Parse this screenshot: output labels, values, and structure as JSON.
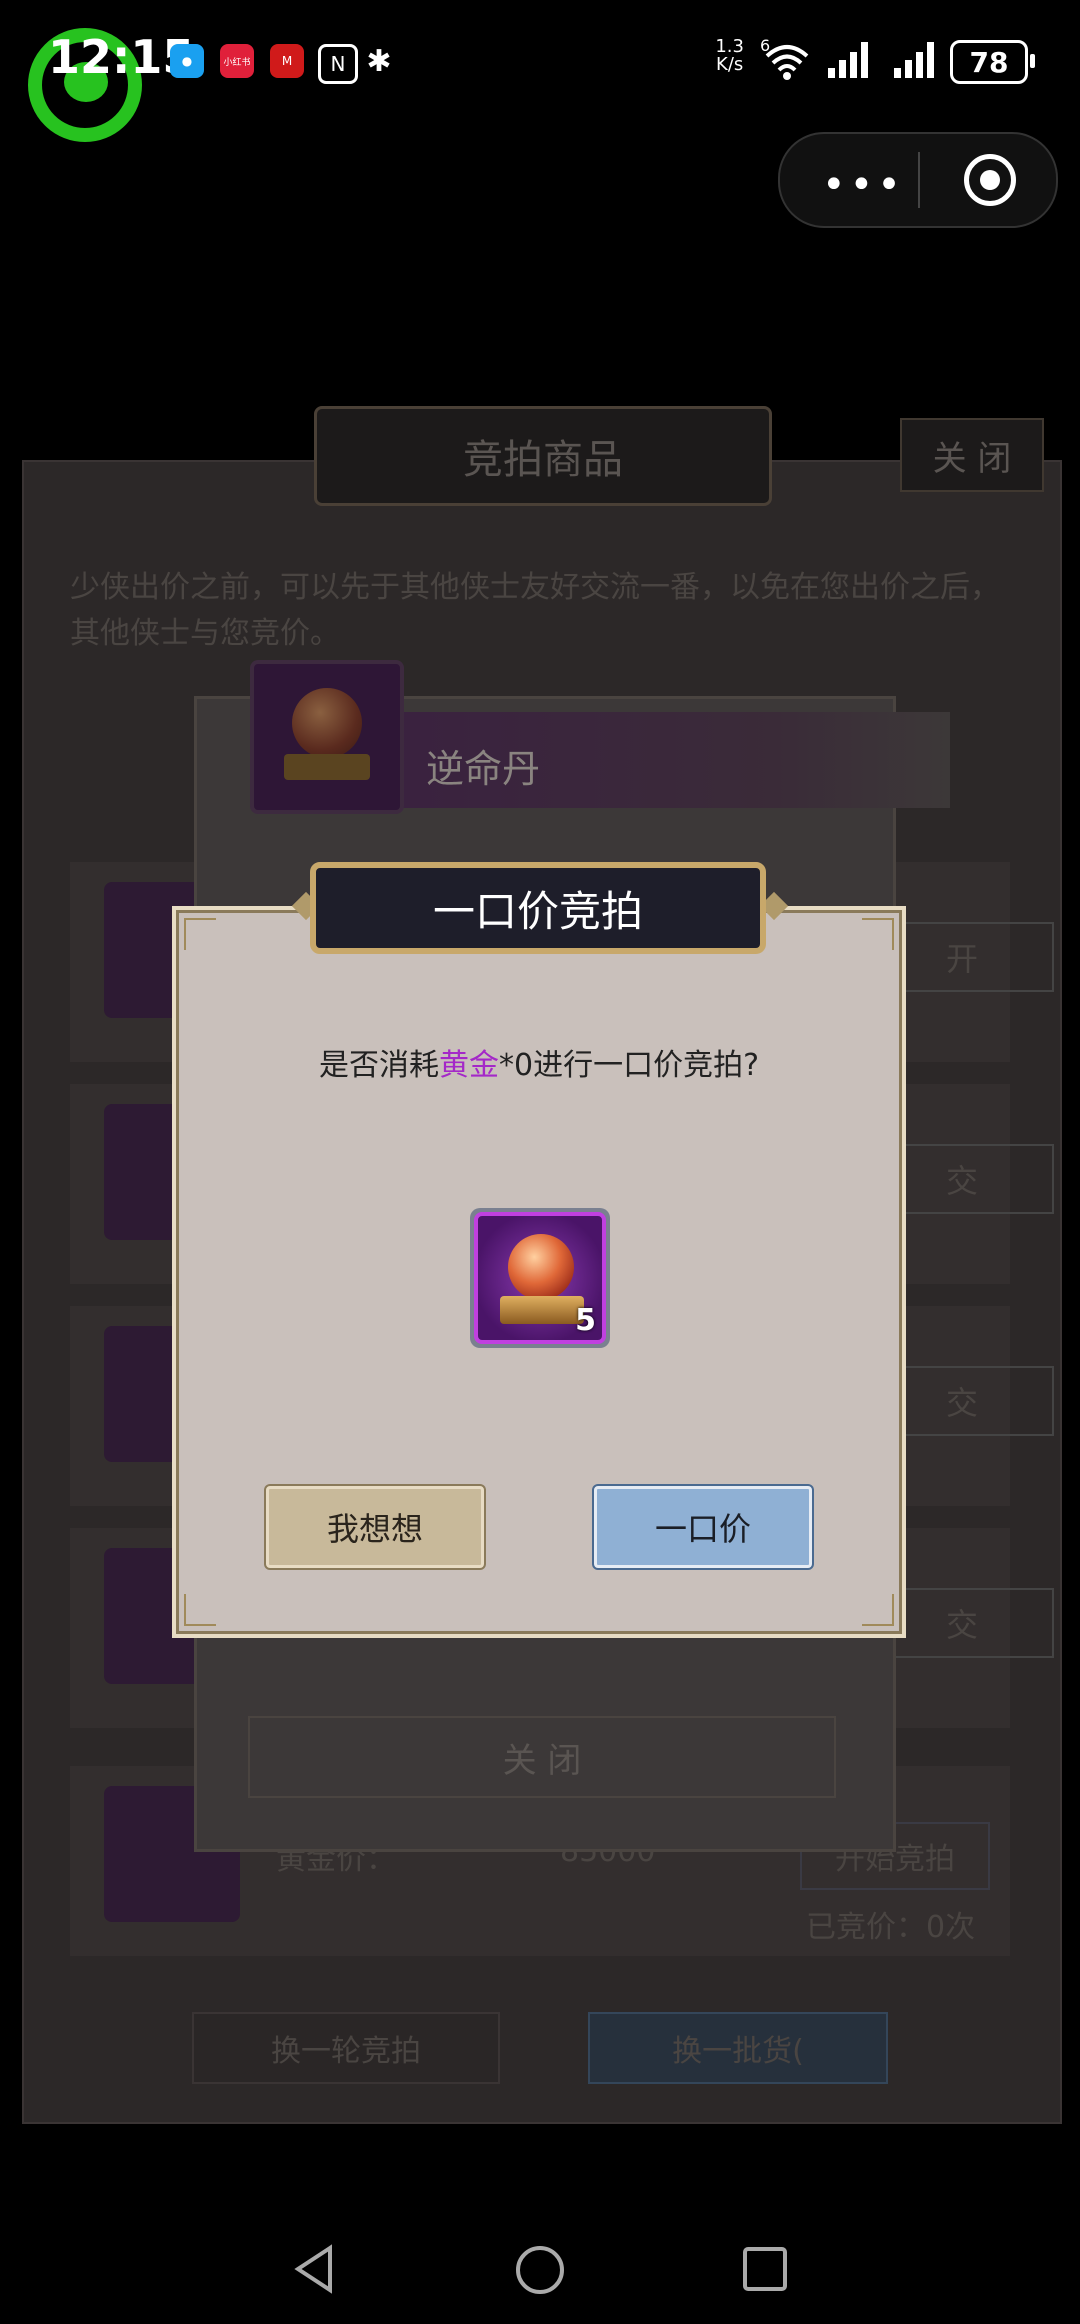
{
  "status_bar": {
    "time": "12:15",
    "net_speed_value": "1.3",
    "net_speed_unit": "K/s",
    "network_type": "6",
    "battery": "78",
    "app_icons": [
      "messages-icon",
      "xiaohongshu-icon",
      "bank-icon",
      "nfc-icon",
      "bluetooth-icon"
    ],
    "xiaohongshu_text": "小红书"
  },
  "background": {
    "panel_title": "竞拍商品",
    "close_label": "关 闭",
    "notice": "少侠出价之前，可以先于其他侠士友好交流一番，以免在您出价之后，其他侠士与您竞价。",
    "gold_price_label": "黄金价：",
    "gold_price_value": "85000",
    "start_auction_label": "开始竞拍",
    "bid_count_label": "已竞价：0次",
    "change_round_label": "换一轮竞拍",
    "refresh_label": "换一批货(",
    "row_buttons": [
      "开",
      "交",
      "交",
      "交"
    ]
  },
  "product_popup": {
    "item_name": "逆命丹",
    "close_label": "关 闭"
  },
  "dialog": {
    "title": "一口价竞拍",
    "question_prefix": "是否消耗",
    "question_currency": "黄金",
    "question_suffix": "*0进行一口价竞拍?",
    "item_quantity": "5",
    "cancel_label": "我想想",
    "confirm_label": "一口价"
  },
  "colors": {
    "currency_highlight": "#a428c8",
    "confirm_button": "#8fb0d4",
    "cancel_button": "#c8b99a"
  }
}
